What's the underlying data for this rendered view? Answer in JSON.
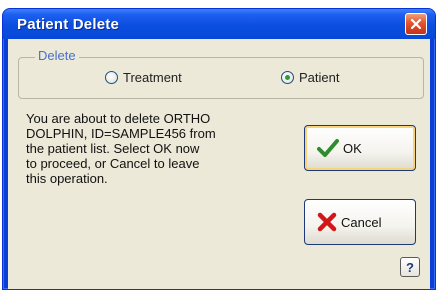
{
  "window": {
    "title": "Patient Delete"
  },
  "delete_group": {
    "label": "Delete",
    "options": [
      {
        "label": "Treatment",
        "selected": false
      },
      {
        "label": "Patient",
        "selected": true
      }
    ]
  },
  "message": "You are about to delete ORTHO\nDOLPHIN, ID=SAMPLE456 from\nthe patient list. Select OK now\nto proceed, or Cancel to leave\nthis operation.",
  "buttons": {
    "ok_label": "OK",
    "cancel_label": "Cancel",
    "help_label": "?"
  },
  "icons": {
    "close": "close-icon",
    "ok": "checkmark-icon",
    "cancel": "red-x-icon"
  },
  "colors": {
    "titlebar": "#0a4fe0",
    "client_bg": "#ece9d8",
    "ok_check": "#2e8b2e",
    "cancel_x": "#d01818",
    "group_label": "#4a6fd0"
  }
}
